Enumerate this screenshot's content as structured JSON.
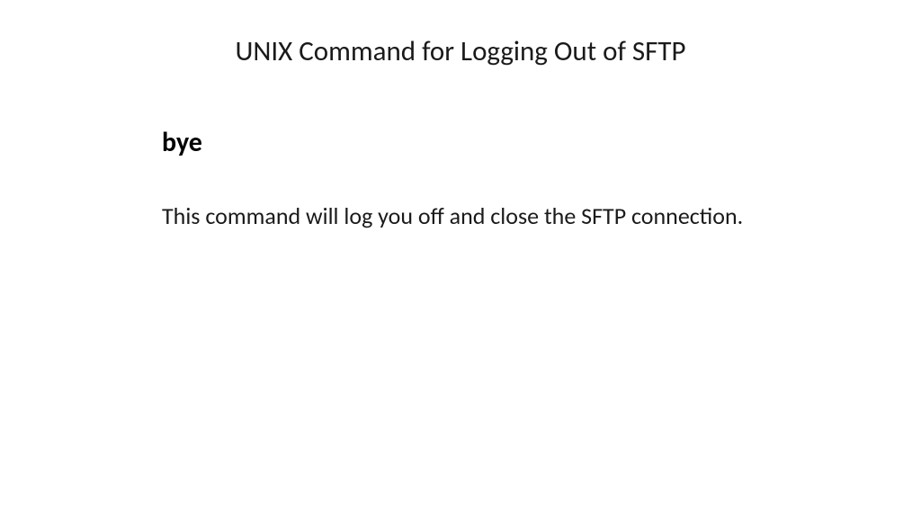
{
  "slide": {
    "title": "UNIX Command for Logging Out of SFTP",
    "command": "bye",
    "description": "This command will log you off and close the SFTP connection."
  }
}
